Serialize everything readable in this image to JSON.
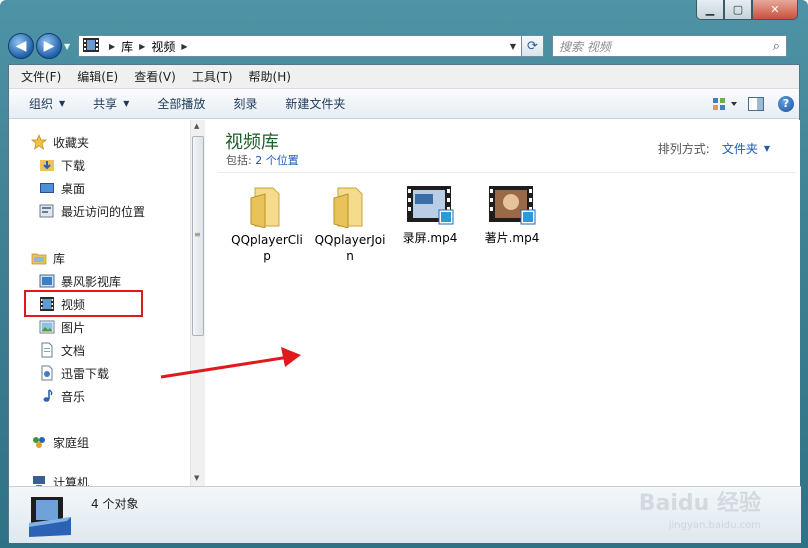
{
  "window": {
    "caption_buttons": [
      "minimize",
      "maximize",
      "close"
    ]
  },
  "nav": {
    "breadcrumb": [
      "库",
      "视频"
    ],
    "search_placeholder": "搜索 视频"
  },
  "menu": [
    "文件(F)",
    "编辑(E)",
    "查看(V)",
    "工具(T)",
    "帮助(H)"
  ],
  "toolbar": {
    "organize": "组织",
    "share": "共享",
    "play_all": "全部播放",
    "burn": "刻录",
    "new_folder": "新建文件夹"
  },
  "sidebar": {
    "favorites": {
      "label": "收藏夹",
      "items": [
        "下载",
        "桌面",
        "最近访问的位置"
      ]
    },
    "libraries": {
      "label": "库",
      "items": [
        "暴风影视库",
        "视频",
        "图片",
        "文档",
        "迅雷下载",
        "音乐"
      ]
    },
    "homegroup": "家庭组",
    "computer": "计算机"
  },
  "content": {
    "title": "视频库",
    "includes_label": "包括:",
    "includes_link": "2 个位置",
    "arrange_label": "排列方式:",
    "arrange_value": "文件夹",
    "files": [
      {
        "name": "QQplayerClip",
        "type": "folder"
      },
      {
        "name": "QQplayerJoin",
        "type": "folder"
      },
      {
        "name": "录屏.mp4",
        "type": "video"
      },
      {
        "name": "著片.mp4",
        "type": "video"
      }
    ]
  },
  "details": {
    "count": "4 个对象"
  },
  "watermark": {
    "line1": "Baidu 经验",
    "line2": "jingyan.baidu.com"
  },
  "colors": {
    "annotation": "#e0191c",
    "library_title": "#1e5e2a",
    "link": "#1a5ab7"
  }
}
